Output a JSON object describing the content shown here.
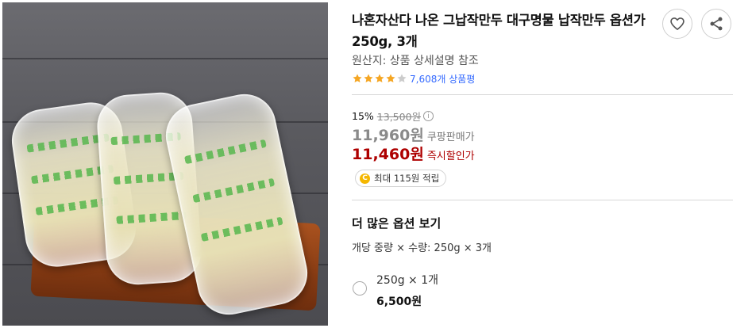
{
  "product": {
    "title": "나혼자산다 나온 그납작만두 대구명물 납작만두 옵션가 250g, 3개",
    "origin": "원산지: 상품 상세설명 참조",
    "rating": 4,
    "max_rating": 5,
    "review_count": "7,608개 상품평"
  },
  "actions": {
    "wishlist_icon": "heart-icon",
    "share_icon": "share-icon"
  },
  "pricing": {
    "discount_rate": "15%",
    "original_price": "13,500원",
    "info_icon": "i",
    "coupang_price": "11,960원",
    "coupang_label": "쿠팡판매가",
    "instant_price": "11,460원",
    "instant_label": "즉시할인가"
  },
  "points": {
    "coin_symbol": "C",
    "text": "최대 115원 적립"
  },
  "options": {
    "heading": "더 많은 옵션 보기",
    "spec": "개당 중량 × 수량: 250g × 3개",
    "items": [
      {
        "name": "250g × 1개",
        "price": "6,500원"
      }
    ]
  },
  "colors": {
    "star_filled": "#f5a623",
    "star_empty": "#cccccc",
    "link": "#346aff",
    "instant_price": "#ae0000"
  }
}
